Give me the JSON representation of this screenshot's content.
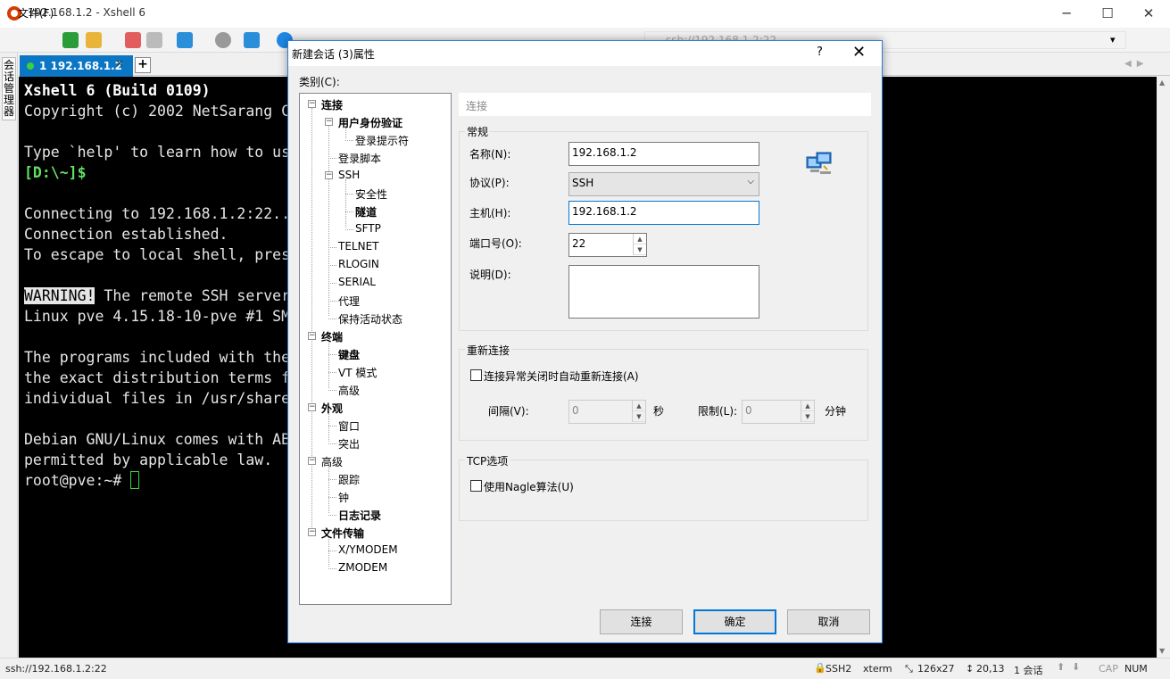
{
  "window": {
    "title": "192.168.1.2 - Xshell 6",
    "min": "─",
    "max": "☐",
    "close": "✕"
  },
  "toolbar": {
    "file_menu": "文件(F)",
    "address": "ssh://192.168.1.2:22"
  },
  "sidestrip": {
    "label": "会话管理器"
  },
  "tabs": [
    {
      "label": "1 192.168.1.2",
      "close": "×"
    }
  ],
  "terminal": {
    "lines": [
      "Xshell 6 (Build 0109)",
      "Copyright (c) 2002 NetSarang C",
      "",
      "Type `help' to learn how to us",
      "[D:\\~]$",
      "",
      "Connecting to 192.168.1.2:22..",
      "Connection established.",
      "To escape to local shell, pres",
      "",
      " The remote SSH server",
      "Linux pve 4.15.18-10-pve #1 SM",
      "",
      "The programs included with the",
      "the exact distribution terms f",
      "individual files in /usr/share",
      "",
      "Debian GNU/Linux comes with AB",
      "permitted by applicable law.",
      "root@pve:~# "
    ],
    "warning_tag": "WARNING!"
  },
  "statusbar": {
    "address": "ssh://192.168.1.2:22",
    "protocol": "SSH2",
    "term": "xterm",
    "size": "126x27",
    "cursor": "20,13",
    "sessions": "1 会话",
    "caps": "CAP",
    "num": "NUM"
  },
  "dialog": {
    "title": "新建会话 (3)属性",
    "help": "?",
    "close": "✕",
    "category_label": "类别(C):",
    "tree": [
      {
        "label": "连接",
        "bold": true,
        "level": 0,
        "expander": "−"
      },
      {
        "label": "用户身份验证",
        "bold": true,
        "level": 1,
        "expander": "−"
      },
      {
        "label": "登录提示符",
        "bold": false,
        "level": 2
      },
      {
        "label": "登录脚本",
        "bold": false,
        "level": 1
      },
      {
        "label": "SSH",
        "bold": false,
        "level": 1,
        "expander": "−"
      },
      {
        "label": "安全性",
        "bold": false,
        "level": 2
      },
      {
        "label": "隧道",
        "bold": true,
        "level": 2
      },
      {
        "label": "SFTP",
        "bold": false,
        "level": 2
      },
      {
        "label": "TELNET",
        "bold": false,
        "level": 1
      },
      {
        "label": "RLOGIN",
        "bold": false,
        "level": 1
      },
      {
        "label": "SERIAL",
        "bold": false,
        "level": 1
      },
      {
        "label": "代理",
        "bold": false,
        "level": 1
      },
      {
        "label": "保持活动状态",
        "bold": false,
        "level": 1
      },
      {
        "label": "终端",
        "bold": true,
        "level": 0,
        "expander": "−"
      },
      {
        "label": "键盘",
        "bold": true,
        "level": 1
      },
      {
        "label": "VT 模式",
        "bold": false,
        "level": 1
      },
      {
        "label": "高级",
        "bold": false,
        "level": 1
      },
      {
        "label": "外观",
        "bold": true,
        "level": 0,
        "expander": "−"
      },
      {
        "label": "窗口",
        "bold": false,
        "level": 1
      },
      {
        "label": "突出",
        "bold": false,
        "level": 1
      },
      {
        "label": "高级",
        "bold": false,
        "level": 0,
        "expander": "−"
      },
      {
        "label": "跟踪",
        "bold": false,
        "level": 1
      },
      {
        "label": "钟",
        "bold": false,
        "level": 1
      },
      {
        "label": "日志记录",
        "bold": true,
        "level": 1
      },
      {
        "label": "文件传输",
        "bold": true,
        "level": 0,
        "expander": "−"
      },
      {
        "label": "X/YMODEM",
        "bold": false,
        "level": 1
      },
      {
        "label": "ZMODEM",
        "bold": false,
        "level": 1
      }
    ],
    "panel_title": "连接",
    "general": {
      "title": "常规",
      "name_label": "名称(N):",
      "name_value": "192.168.1.2",
      "protocol_label": "协议(P):",
      "protocol_value": "SSH",
      "host_label": "主机(H):",
      "host_value": "192.168.1.2",
      "port_label": "端口号(O):",
      "port_value": "22",
      "desc_label": "说明(D):",
      "desc_value": ""
    },
    "reconnect": {
      "title": "重新连接",
      "auto_label": "连接异常关闭时自动重新连接(A)",
      "interval_label": "间隔(V):",
      "interval_value": "0",
      "interval_unit": "秒",
      "limit_label": "限制(L):",
      "limit_value": "0",
      "limit_unit": "分钟"
    },
    "tcp": {
      "title": "TCP选项",
      "nagle_label": "使用Nagle算法(U)"
    },
    "buttons": {
      "connect": "连接",
      "ok": "确定",
      "cancel": "取消"
    }
  }
}
